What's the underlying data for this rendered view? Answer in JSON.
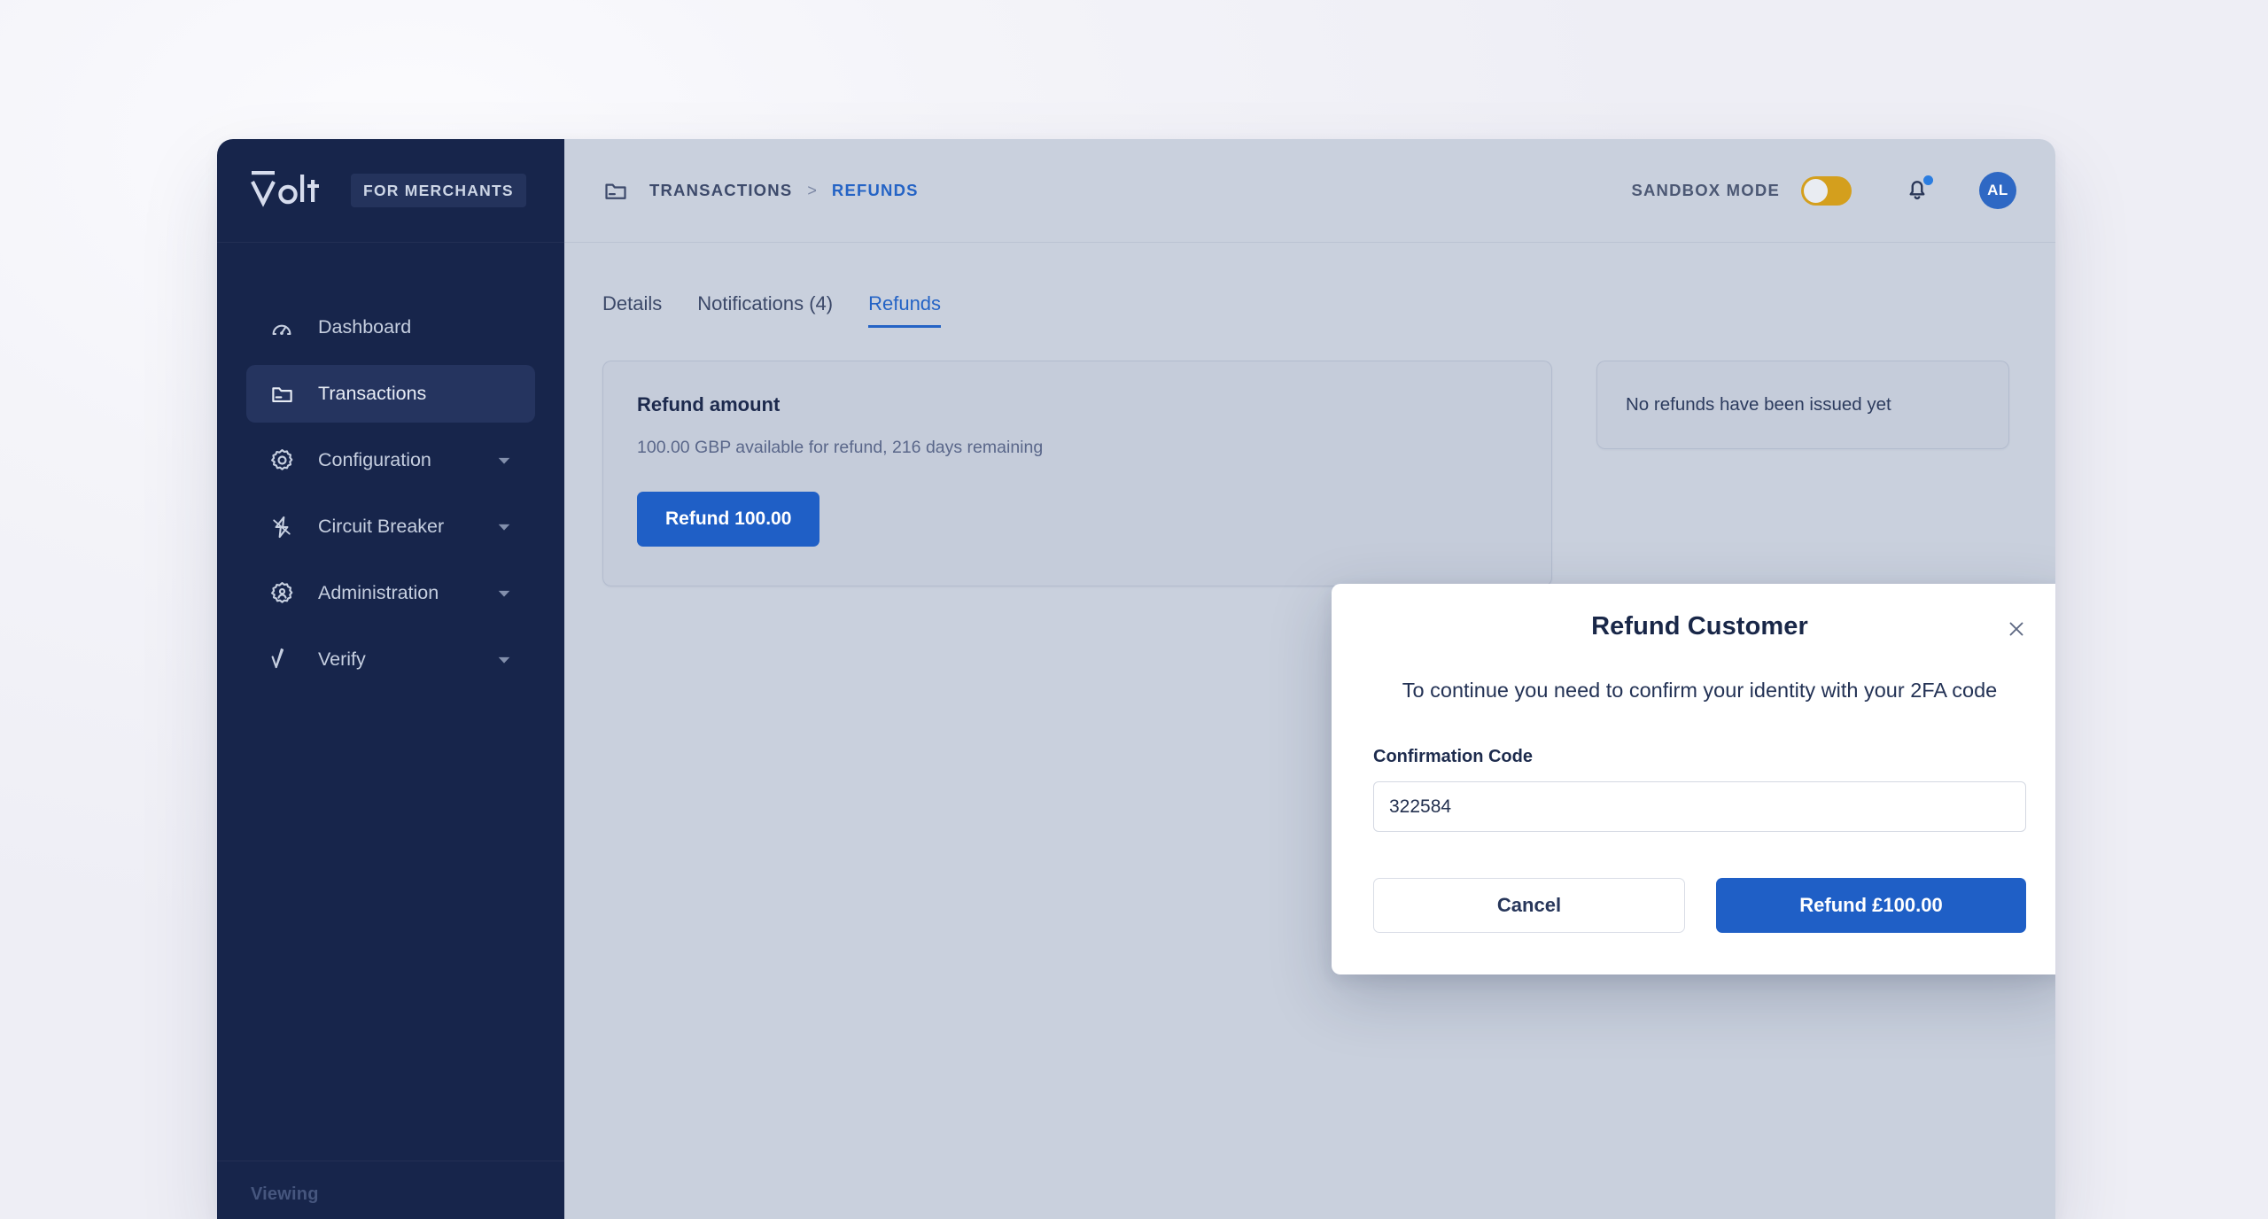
{
  "brand": {
    "logo_text": "volt",
    "merchant_badge": "FOR MERCHANTS"
  },
  "colors": {
    "sidebar_bg": "#17254b",
    "sidebar_active": "#25345f",
    "main_bg": "#c9d0dd",
    "accent_blue": "#1f5fc6",
    "link_blue": "#2463c5",
    "sandbox_amber": "#d49f1d",
    "avatar_blue": "#2e68c4",
    "notification_dot": "#2b7de0",
    "modal_bg": "#ffffff",
    "page_bg": "#f4f4f9"
  },
  "sidebar": {
    "items": [
      {
        "label": "Dashboard",
        "icon": "gauge-icon",
        "active": false,
        "has_caret": false
      },
      {
        "label": "Transactions",
        "icon": "folder-icon",
        "active": true,
        "has_caret": false
      },
      {
        "label": "Configuration",
        "icon": "gear-icon",
        "active": false,
        "has_caret": true
      },
      {
        "label": "Circuit Breaker",
        "icon": "lightning-bolt-icon",
        "active": false,
        "has_caret": true
      },
      {
        "label": "Administration",
        "icon": "gear-user-icon",
        "active": false,
        "has_caret": true
      },
      {
        "label": "Verify",
        "icon": "check-badge-icon",
        "active": false,
        "has_caret": true
      }
    ],
    "footer_label": "Viewing"
  },
  "topbar": {
    "breadcrumb": {
      "icon": "folder-icon",
      "parent": "TRANSACTIONS",
      "separator": ">",
      "current": "REFUNDS"
    },
    "sandbox_label": "SANDBOX MODE",
    "sandbox_enabled": false,
    "bell_icon": "bell-icon",
    "has_notification": true,
    "avatar_initials": "AL"
  },
  "tabs": [
    {
      "label": "Details",
      "active": false
    },
    {
      "label": "Notifications (4)",
      "active": false
    },
    {
      "label": "Refunds",
      "active": true
    }
  ],
  "content": {
    "refund_card": {
      "title": "Refund amount",
      "subtitle": "100.00 GBP available for refund, 216 days remaining",
      "button_label": "Refund 100.00"
    },
    "refunds_list_card": {
      "empty_text": "No refunds have been issued yet"
    }
  },
  "modal": {
    "title": "Refund Customer",
    "close_icon": "close-icon",
    "body_text": "To continue you need to confirm your identity with your 2FA code",
    "field_label": "Confirmation Code",
    "code_value": "322584",
    "code_placeholder": "Confirmation Code",
    "cancel_label": "Cancel",
    "confirm_label": "Refund £100.00"
  }
}
